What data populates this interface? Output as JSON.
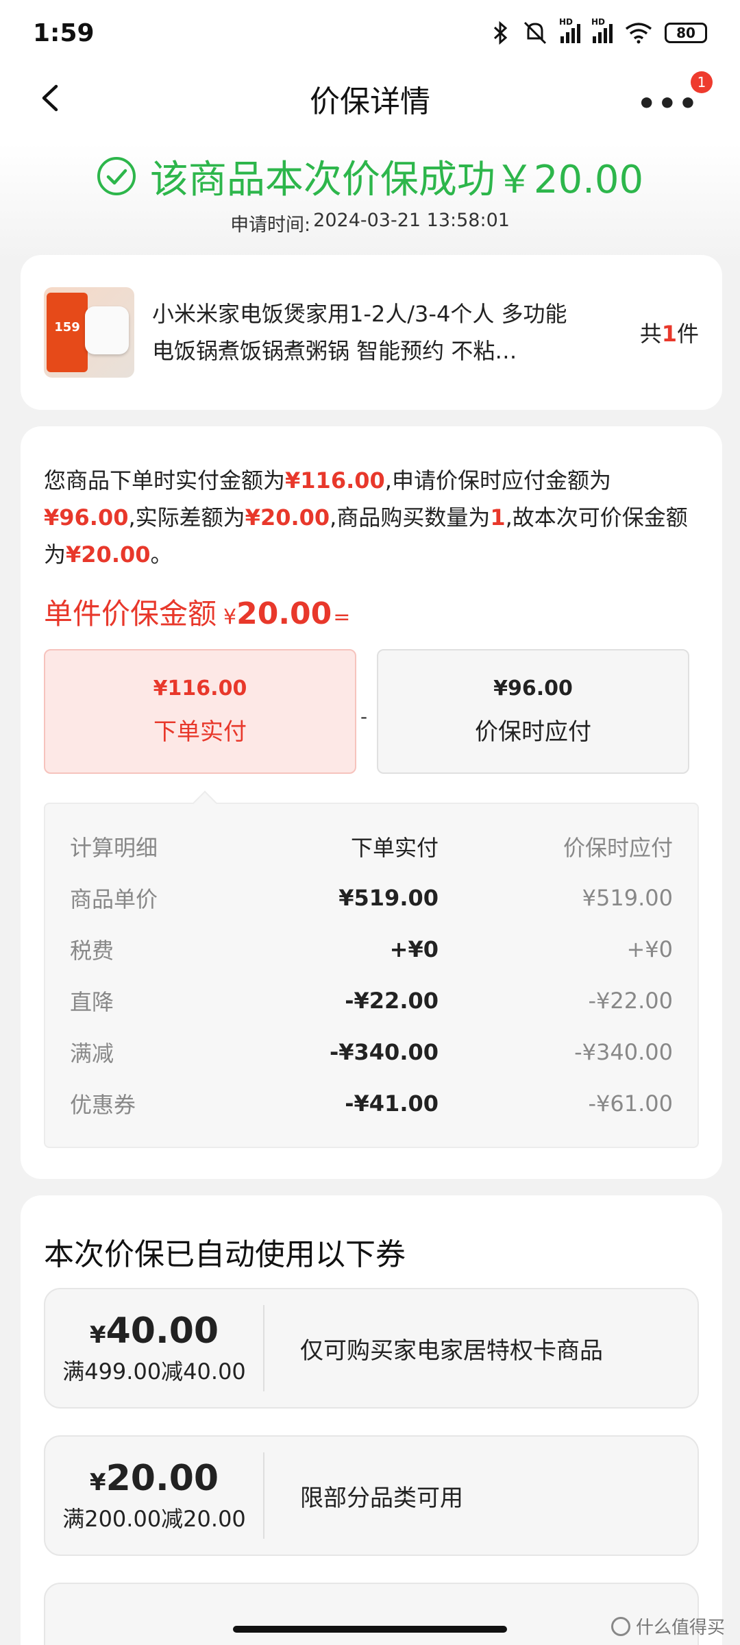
{
  "status_bar": {
    "time": "1:59",
    "battery": "80"
  },
  "nav": {
    "title": "价保详情",
    "more_badge": "1"
  },
  "header": {
    "success_text": "该商品本次价保成功￥20.00",
    "apply_time_label": "申请时间:",
    "apply_time_value": "2024-03-21 13:58:01"
  },
  "product": {
    "name": "小米米家电饭煲家用1-2人/3-4个人 多功能电饭锅煮饭锅煮粥锅 智能预约 不粘…",
    "promo_price": "159",
    "qty_prefix": "共",
    "qty_value": "1",
    "qty_suffix": "件"
  },
  "explanation": {
    "t1": "您商品下单时实付金额为",
    "paid": "¥116.00",
    "t2": ",申请价保时应付金额为",
    "payable": "¥96.00",
    "t3": ",实际差额为",
    "diff": "¥20.00",
    "t4": ",商品购买数量为",
    "count": "1",
    "t5": ",故本次可价保金额为",
    "refund": "¥20.00",
    "t6": "。"
  },
  "unit_amount": {
    "label": "单件价保金额",
    "currency": "¥",
    "value": "20.00",
    "eq": "="
  },
  "compare": {
    "paid_value": "¥116.00",
    "paid_label": "下单实付",
    "minus": "-",
    "protect_value": "¥96.00",
    "protect_label": "价保时应付"
  },
  "calc": {
    "header": [
      "计算明细",
      "下单实付",
      "价保时应付"
    ],
    "rows": [
      [
        "商品单价",
        "¥519.00",
        "¥519.00"
      ],
      [
        "税费",
        "+¥0",
        "+¥0"
      ],
      [
        "直降",
        "-¥22.00",
        "-¥22.00"
      ],
      [
        "满减",
        "-¥340.00",
        "-¥340.00"
      ],
      [
        "优惠券",
        "-¥41.00",
        "-¥61.00"
      ]
    ]
  },
  "coupons": {
    "title": "本次价保已自动使用以下券",
    "items": [
      {
        "currency": "¥",
        "amount": "40.00",
        "condition": "满499.00减40.00",
        "desc": "仅可购买家电家居特权卡商品"
      },
      {
        "currency": "¥",
        "amount": "20.00",
        "condition": "满200.00减20.00",
        "desc": "限部分品类可用"
      }
    ]
  },
  "watermark": "什么值得买",
  "colors": {
    "success_green": "#2db64b",
    "price_red": "#e8382b",
    "background": "#f2f2f2"
  }
}
